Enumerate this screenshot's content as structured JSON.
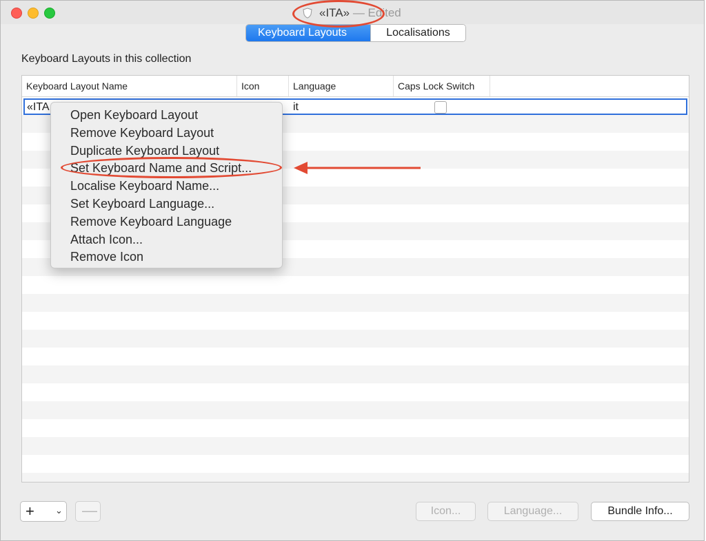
{
  "window": {
    "title": "«ITA»",
    "title_suffix": " — Edited",
    "doc_icon": "keyboard-bundle-icon"
  },
  "tabs": [
    {
      "label": "Keyboard Layouts",
      "active": true
    },
    {
      "label": "Localisations",
      "active": false
    }
  ],
  "section": {
    "label": "Keyboard Layouts in this collection"
  },
  "table": {
    "columns": [
      "Keyboard Layout Name",
      "Icon",
      "Language",
      "Caps Lock Switch"
    ],
    "rows": [
      {
        "name": "«ITA",
        "icon": "italy-flag-icon",
        "language": "it",
        "caps_lock_switch": false
      }
    ]
  },
  "context_menu": {
    "items": [
      "Open Keyboard Layout",
      "Remove Keyboard Layout",
      "Duplicate Keyboard Layout",
      "Set Keyboard Name and Script...",
      "Localise Keyboard Name...",
      "Set Keyboard Language...",
      "Remove Keyboard Language",
      "Attach Icon...",
      "Remove Icon"
    ],
    "highlighted_item": "Set Keyboard Name and Script..."
  },
  "bottom": {
    "add_symbol": "+",
    "remove_symbol": "—",
    "icon_button": "Icon...",
    "language_button": "Language...",
    "bundle_info_button": "Bundle Info..."
  },
  "colors": {
    "accent": "#1e78ee",
    "annotation": "#e24a33",
    "close": "#fe5f57",
    "minimize": "#febc2e",
    "zoom": "#28c840"
  }
}
